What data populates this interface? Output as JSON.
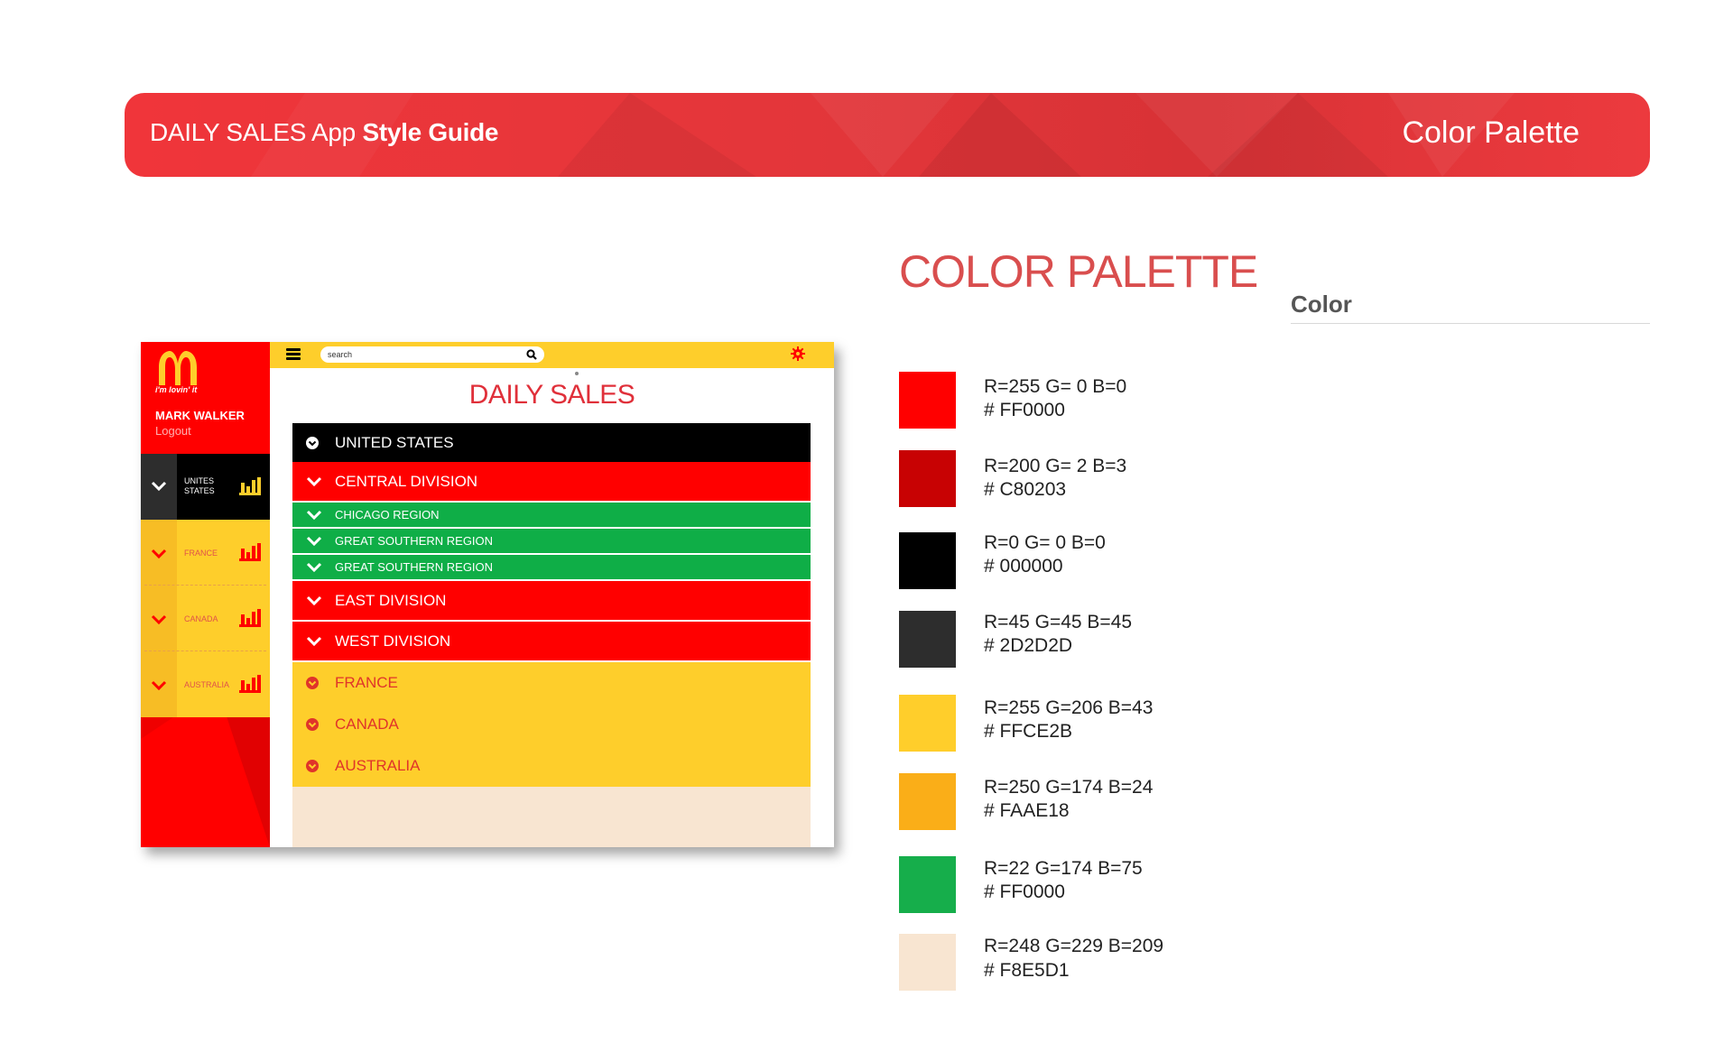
{
  "header": {
    "app_name": "DAILY SALES App",
    "doc_name": "Style Guide",
    "section": "Color Palette"
  },
  "palette": {
    "heading": "COLOR PALETTE",
    "column_label": "Color",
    "colors": [
      {
        "rgb": "R=255 G= 0 B=0",
        "hex": "# FF0000",
        "swatch": "#FF0000"
      },
      {
        "rgb": "R=200 G= 2 B=3",
        "hex": "# C80203",
        "swatch": "#C80203"
      },
      {
        "rgb": "R=0 G= 0 B=0",
        "hex": "# 000000",
        "swatch": "#000000"
      },
      {
        "rgb": "R=45 G=45 B=45",
        "hex": "# 2D2D2D",
        "swatch": "#2D2D2D"
      },
      {
        "rgb": "R=255 G=206 B=43",
        "hex": "# FFCE2B",
        "swatch": "#FFCE2B"
      },
      {
        "rgb": "R=250 G=174 B=24",
        "hex": "# FAAE18",
        "swatch": "#FAAE18"
      },
      {
        "rgb": "R=22 G=174 B=75",
        "hex": "# FF0000",
        "swatch": "#16AE4B"
      },
      {
        "rgb": "R=248 G=229 B=209",
        "hex": "# F8E5D1",
        "swatch": "#F8E5D1"
      }
    ]
  },
  "app": {
    "tagline": "i'm lovin' it",
    "user_name": "MARK WALKER",
    "logout": "Logout",
    "search_placeholder": "search",
    "title": "DAILY SALES",
    "sidebar": [
      {
        "label": "UNITES STATES",
        "icon": "bar-chart-icon"
      },
      {
        "label": "FRANCE",
        "icon": "bar-chart-icon"
      },
      {
        "label": "CANADA",
        "icon": "bar-chart-icon"
      },
      {
        "label": "AUSTRALIA",
        "icon": "bar-chart-icon"
      }
    ],
    "list": {
      "country": "UNITED STATES",
      "central": "CENTRAL DIVISION",
      "regions": [
        "CHICAGO REGION",
        "GREAT SOUTHERN REGION",
        "GREAT SOUTHERN REGION"
      ],
      "east": "EAST DIVISION",
      "west": "WEST DIVISION",
      "others": [
        "FRANCE",
        "CANADA",
        "AUSTRALIA"
      ]
    }
  }
}
